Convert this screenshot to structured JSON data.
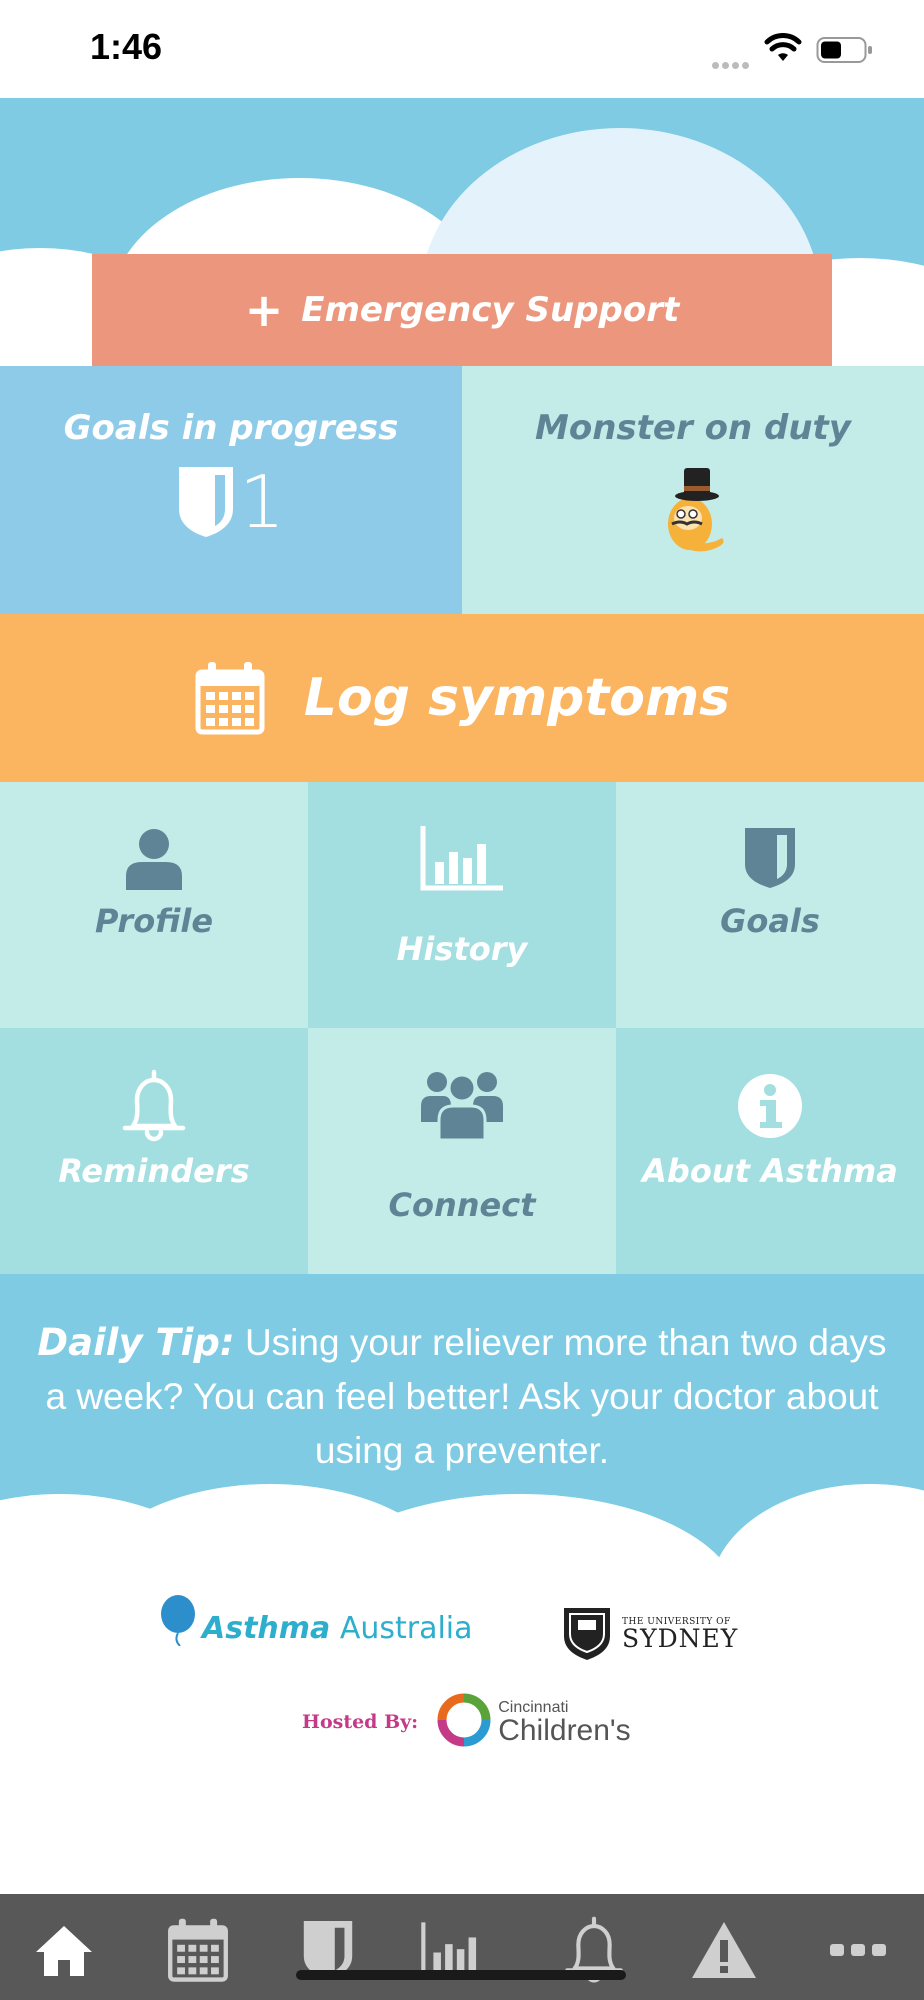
{
  "status_bar": {
    "time": "1:46"
  },
  "emergency": {
    "label": "Emergency Support",
    "icon": "plus-icon"
  },
  "goals_tile": {
    "title": "Goals in progress",
    "count": "1",
    "icon": "shield-icon"
  },
  "monster_tile": {
    "title": "Monster on duty",
    "icon": "monster-icon"
  },
  "log_symptoms": {
    "label": "Log symptoms",
    "icon": "calendar-icon"
  },
  "menu": {
    "profile": "Profile",
    "history": "History",
    "goals": "Goals",
    "reminders": "Reminders",
    "connect": "Connect",
    "about": "About Asthma"
  },
  "tip": {
    "label": "Daily Tip:",
    "text": " Using your reliever more than two days a week? You can feel better! Ask your doctor about using a preventer."
  },
  "logos": {
    "asthma_bold": "Asthma",
    "asthma_rest": " Australia",
    "sydney_small": "THE UNIVERSITY OF",
    "sydney_big": "SYDNEY",
    "hosted_by": "Hosted By:",
    "cch_small": "Cincinnati",
    "cch_big": "Children's"
  },
  "tabbar": {
    "icons": [
      "home-icon",
      "calendar-icon",
      "shield-icon",
      "bar-chart-icon",
      "bell-icon",
      "warning-icon",
      "more-icon"
    ]
  },
  "colors": {
    "hero": "#7ecbe3",
    "emergency": "#ec977d",
    "goals_tile": "#8ecbe8",
    "light_tile": "#c3ece8",
    "dark_tile": "#a3dfe0",
    "log": "#fbb460",
    "tabbar": "#585858",
    "icon_slate": "#5e8496"
  }
}
